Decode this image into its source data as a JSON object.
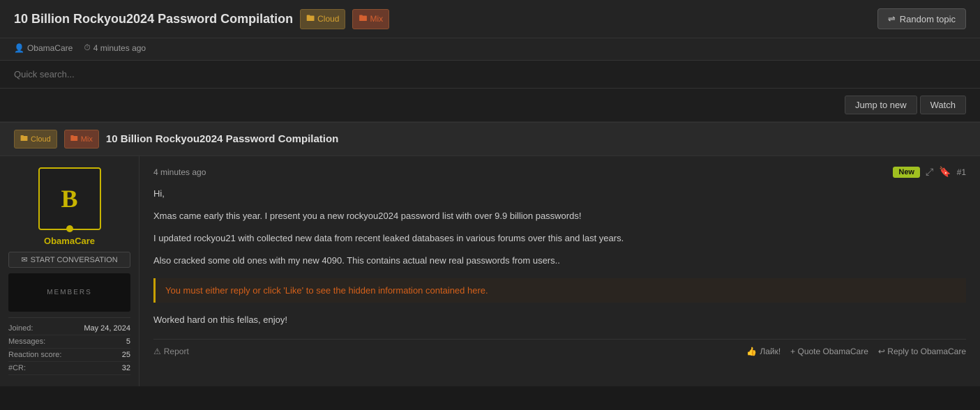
{
  "header": {
    "title": "10 Billion Rockyou2024 Password Compilation",
    "tags": [
      {
        "label": "Cloud",
        "class": "tag-cloud"
      },
      {
        "label": "Mix",
        "class": "tag-mix"
      }
    ],
    "random_topic_label": "Random topic",
    "random_icon": "⇌"
  },
  "meta": {
    "author": "ObamaCare",
    "time_ago": "4 minutes ago"
  },
  "search": {
    "placeholder": "Quick search..."
  },
  "actions": {
    "jump_to_new": "Jump to new",
    "watch": "Watch"
  },
  "post_strip": {
    "title": "10 Billion Rockyou2024 Password Compilation",
    "tags": [
      {
        "label": "Cloud",
        "class": "tag-cloud"
      },
      {
        "label": "Mix",
        "class": "tag-mix"
      }
    ]
  },
  "post": {
    "time_ago": "4 minutes ago",
    "number": "#1",
    "new_badge": "New",
    "content": {
      "line1": "Hi,",
      "line2": "Xmas came early this year. I present you a new rockyou2024 password list with over 9.9 billion passwords!",
      "line3": "I updated rockyou21 with collected new data from recent leaked databases in various forums over this and last years.",
      "line4": "Also cracked some old ones with my new 4090. This contains actual new real passwords from users..",
      "hidden_info": "You must either reply or click 'Like' to see the hidden information contained here.",
      "line5": "Worked hard on this fellas, enjoy!"
    },
    "footer": {
      "report": "Report",
      "like": "Лайк!",
      "quote": "+ Quote ObamaCare",
      "reply": "↩ Reply to ObamaCare"
    }
  },
  "user": {
    "name": "ObamaCare",
    "avatar_letter": "B",
    "start_conv": "START CONVERSATION",
    "banner_text": "MEMBERS",
    "stats": [
      {
        "label": "Joined:",
        "value": "May 24, 2024"
      },
      {
        "label": "Messages:",
        "value": "5"
      },
      {
        "label": "Reaction score:",
        "value": "25"
      },
      {
        "label": "#CR:",
        "value": "32"
      }
    ]
  }
}
